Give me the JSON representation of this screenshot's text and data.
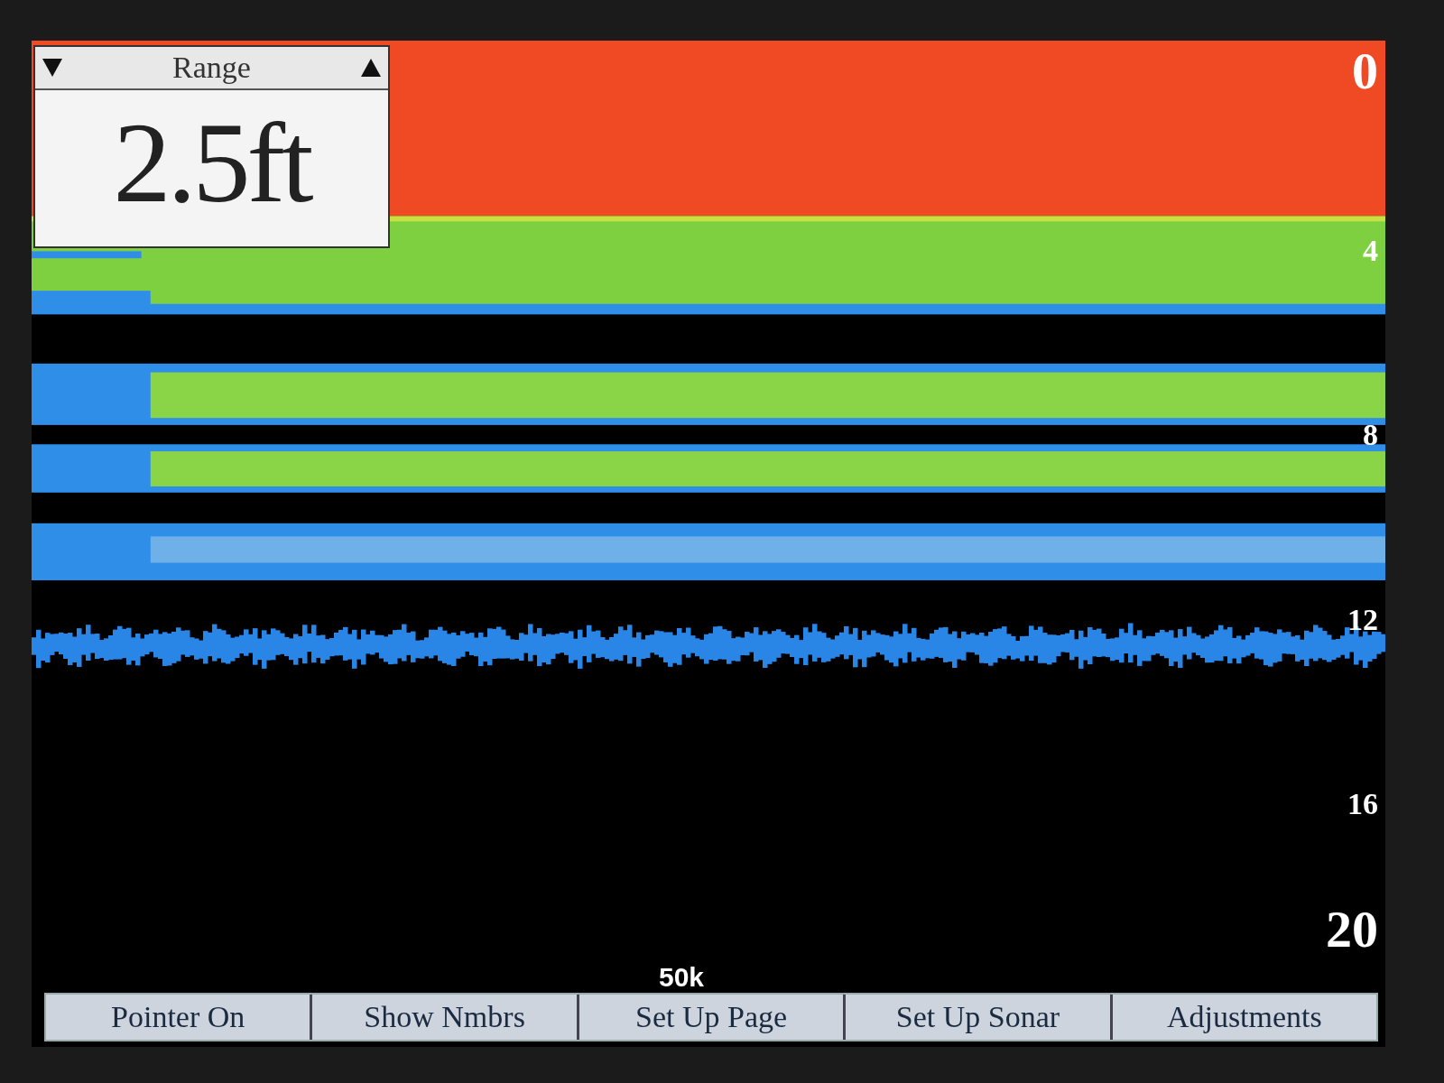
{
  "range_box": {
    "title": "Range",
    "value": "2.5ft"
  },
  "depth_scale": [
    "0",
    "4",
    "8",
    "12",
    "16",
    "20"
  ],
  "frequency": "50k",
  "softkeys": [
    "Pointer On",
    "Show Nmbrs",
    "Set Up Page",
    "Set Up Sonar",
    "Adjustments"
  ]
}
